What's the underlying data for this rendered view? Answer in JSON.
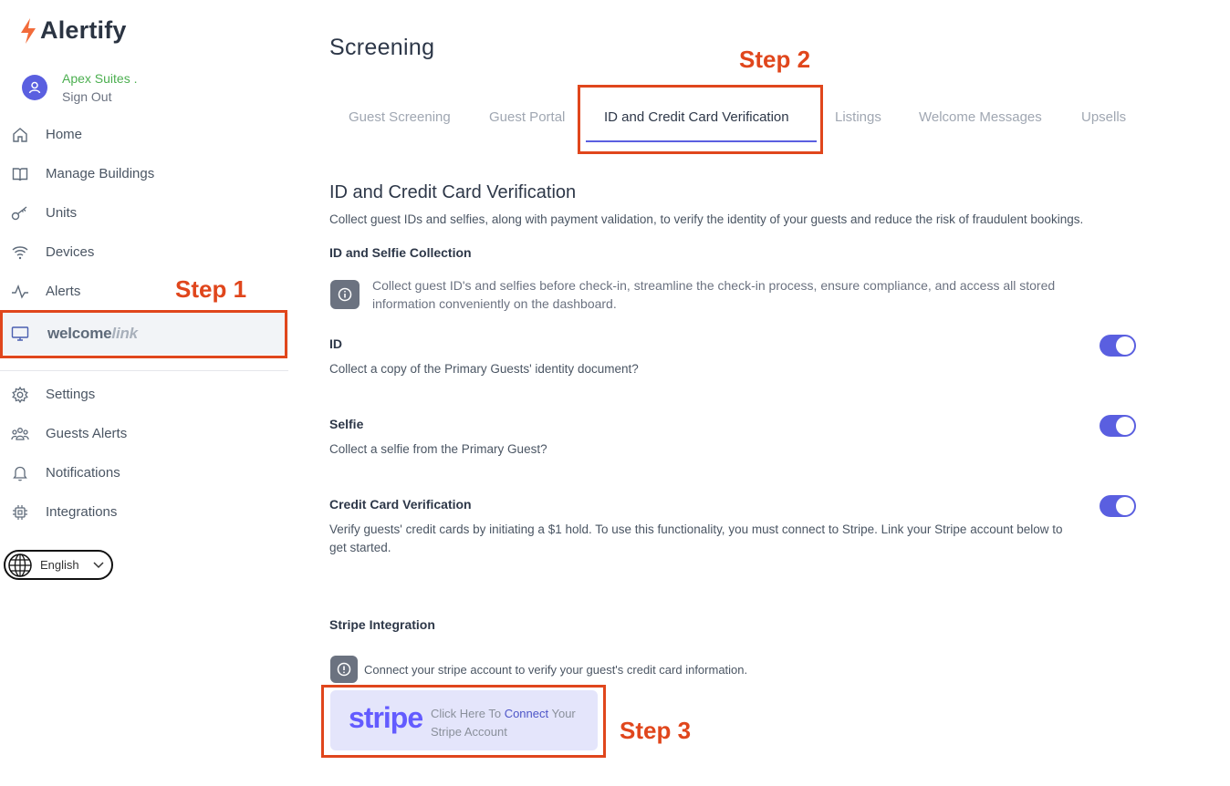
{
  "app": {
    "logo_text": "Alertify"
  },
  "user": {
    "name": "Apex Suites .",
    "sign_out": "Sign Out"
  },
  "sidebar": {
    "items": [
      {
        "label": "Home",
        "icon": "home-icon"
      },
      {
        "label": "Manage Buildings",
        "icon": "book-icon"
      },
      {
        "label": "Units",
        "icon": "key-icon"
      },
      {
        "label": "Devices",
        "icon": "wifi-icon"
      },
      {
        "label": "Alerts",
        "icon": "activity-icon"
      },
      {
        "label_bold": "welcome",
        "label_light": "link",
        "icon": "monitor-icon",
        "active": true
      },
      {
        "label": "Settings",
        "icon": "gear-icon"
      },
      {
        "label": "Guests Alerts",
        "icon": "users-icon"
      },
      {
        "label": "Notifications",
        "icon": "bell-icon"
      },
      {
        "label": "Integrations",
        "icon": "chip-icon"
      }
    ],
    "language": "English"
  },
  "annotations": {
    "step1": "Step 1",
    "step2": "Step 2",
    "step3": "Step 3"
  },
  "main": {
    "title": "Screening",
    "tabs": [
      {
        "label": "Guest Screening"
      },
      {
        "label": "Guest Portal"
      },
      {
        "label": "ID and Credit Card Verification",
        "active": true
      },
      {
        "label": "Listings"
      },
      {
        "label": "Welcome Messages"
      },
      {
        "label": "Upsells"
      }
    ],
    "section_title": "ID and Credit Card Verification",
    "section_desc": "Collect guest IDs and selfies, along with payment validation, to verify the identity of your guests and reduce the risk of fraudulent bookings.",
    "collection_title": "ID and Selfie Collection",
    "collection_info": "Collect guest ID's and selfies before check-in, streamline the check-in process, ensure compliance, and access all stored information conveniently on the dashboard.",
    "settings": [
      {
        "title": "ID",
        "desc": "Collect a copy of the Primary Guests' identity document?",
        "enabled": true
      },
      {
        "title": "Selfie",
        "desc": "Collect a selfie from the Primary Guest?",
        "enabled": true
      },
      {
        "title": "Credit Card Verification",
        "desc": "Verify guests' credit cards by initiating a $1 hold. To use this functionality, you must connect to Stripe. Link your Stripe account below to get started.",
        "enabled": true
      }
    ],
    "stripe": {
      "title": "Stripe Integration",
      "info": "Connect your stripe account to verify your guest's credit card information.",
      "logo": "stripe",
      "btn_pre": "Click Here To ",
      "btn_connect": "Connect",
      "btn_post": " Your",
      "btn_line2": "Stripe Account"
    }
  },
  "colors": {
    "accent": "#5a5fe0",
    "annotation": "#e0461c",
    "brand_orange": "#f26b3a",
    "stripe": "#635bff"
  }
}
